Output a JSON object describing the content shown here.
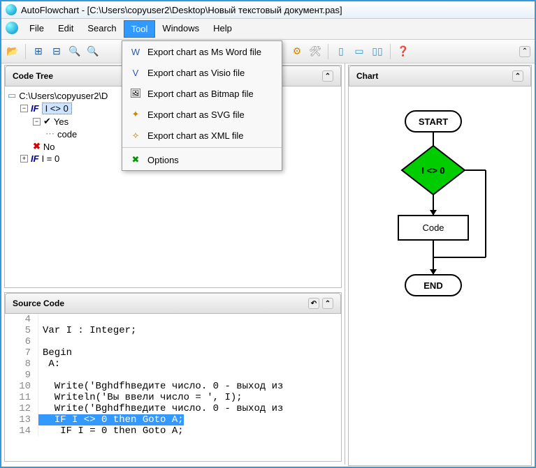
{
  "title": "AutoFlowchart - [C:\\Users\\copyuser2\\Desktop\\Новый текстовый документ.pas]",
  "menu": {
    "file": "File",
    "edit": "Edit",
    "search": "Search",
    "tool": "Tool",
    "windows": "Windows",
    "help": "Help"
  },
  "dropdown": {
    "word": "Export chart as Ms Word file",
    "visio": "Export chart as Visio file",
    "bitmap": "Export chart as Bitmap file",
    "svg": "Export chart as SVG file",
    "xml": "Export chart as XML file",
    "options": "Options"
  },
  "panels": {
    "codetree": "Code Tree",
    "sourcecode": "Source Code",
    "chart": "Chart"
  },
  "tree": {
    "root": "C:\\Users\\copyuser2\\D",
    "if1": "I <> 0",
    "yes": "Yes",
    "code": "code",
    "no": "No",
    "if2": "I = 0"
  },
  "code": {
    "l4": "",
    "l5": "Var I : Integer;",
    "l6": "",
    "l7": "Begin",
    "l8": " A:",
    "l9": "",
    "l10": "  Write('Bghdfhведите число. 0 - выход из",
    "l11": "  Writeln('Вы ввели число = ', I);",
    "l12": "  Write('Bghdfhведите число. 0 - выход из",
    "l13": "  IF I <> 0 then Goto A;",
    "l14": "   IF I = 0 then Goto A;"
  },
  "chart": {
    "start": "START",
    "cond": "I <> 0",
    "box": "Code",
    "end": "END"
  }
}
